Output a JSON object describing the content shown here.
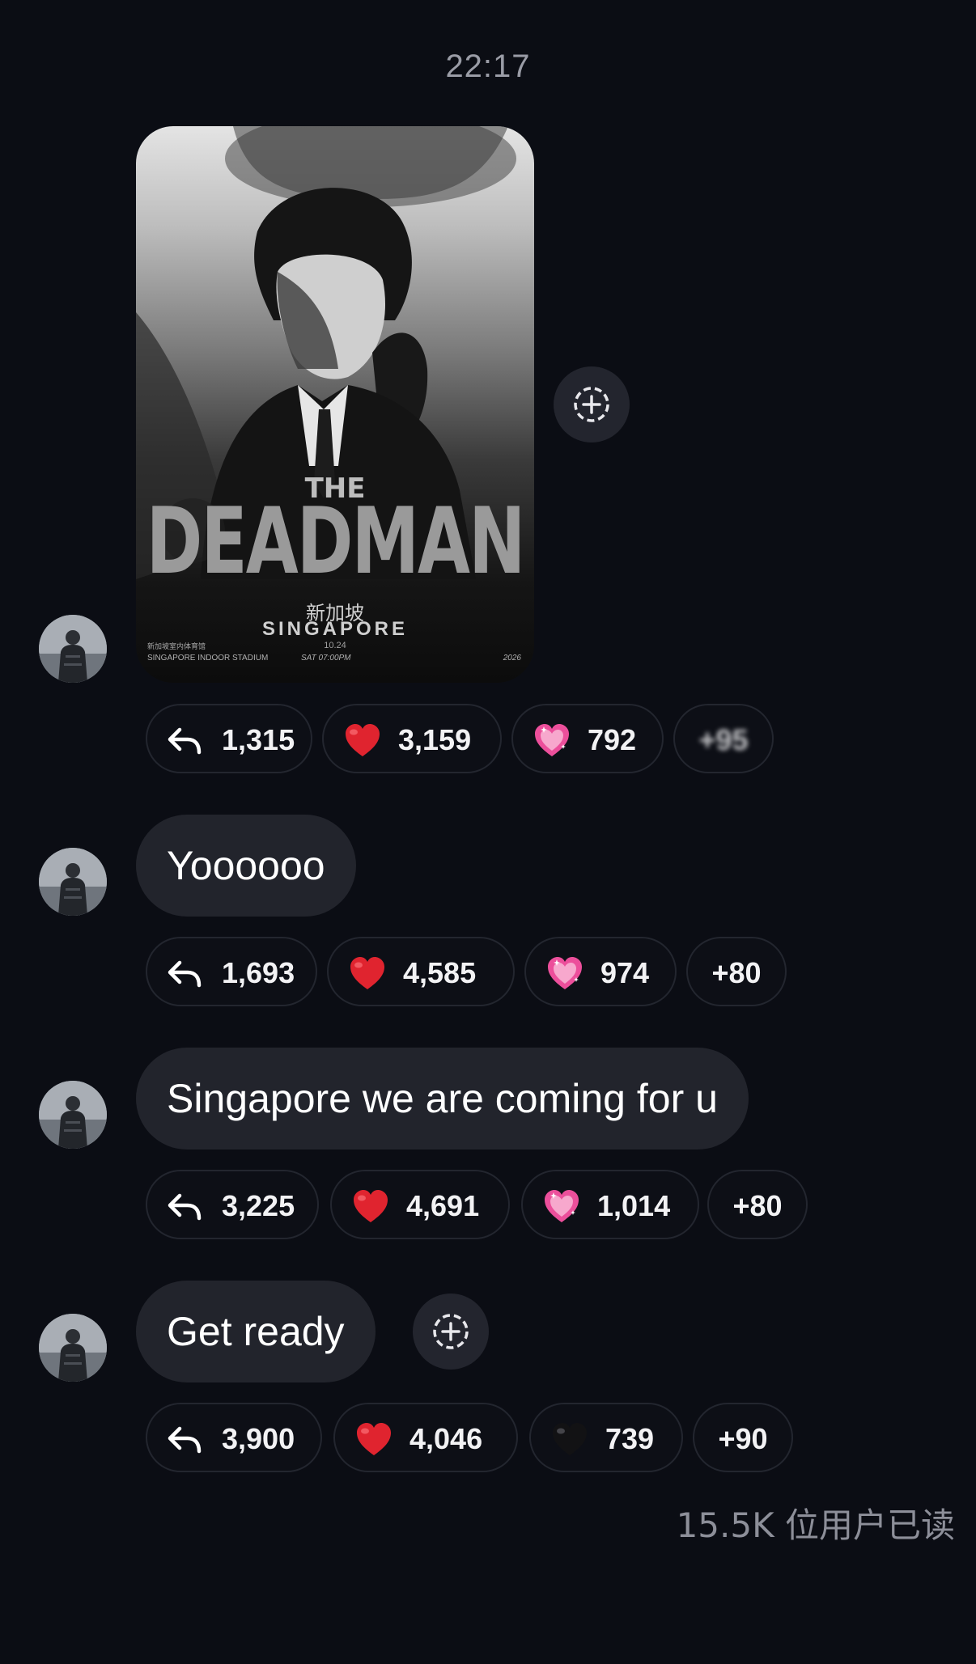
{
  "chat": {
    "timestamp": "22:17",
    "read_receipt": "15.5K 位用户已读"
  },
  "poster": {
    "the": "THE",
    "title": "DEADMAN",
    "city_cn": "新加坡",
    "city": "SINGAPORE",
    "date": "10.24",
    "venue_cn": "新加坡室内体育馆",
    "venue": "SINGAPORE INDOOR STADIUM",
    "time": "SAT 07:00PM",
    "year": "2026"
  },
  "messages": [
    {
      "type": "image",
      "reactions": {
        "reply": "1,315",
        "red_heart": "3,159",
        "sparkle_heart": "792",
        "more": "+95"
      }
    },
    {
      "type": "text",
      "text": "Yoooooo",
      "reactions": {
        "reply": "1,693",
        "red_heart": "4,585",
        "sparkle_heart": "974",
        "more": "+80"
      }
    },
    {
      "type": "text",
      "text": "Singapore we are coming for u",
      "reactions": {
        "reply": "3,225",
        "red_heart": "4,691",
        "sparkle_heart": "1,014",
        "more": "+80"
      }
    },
    {
      "type": "text",
      "text": "Get ready",
      "reactions": {
        "reply": "3,900",
        "red_heart": "4,046",
        "black_heart": "739",
        "more": "+90"
      }
    }
  ],
  "colors": {
    "background": "#0b0d14",
    "bubble": "#22242c",
    "chip_border": "#23262f",
    "red_heart": "#e0242f",
    "sparkle_heart": "#ec4f9b"
  }
}
